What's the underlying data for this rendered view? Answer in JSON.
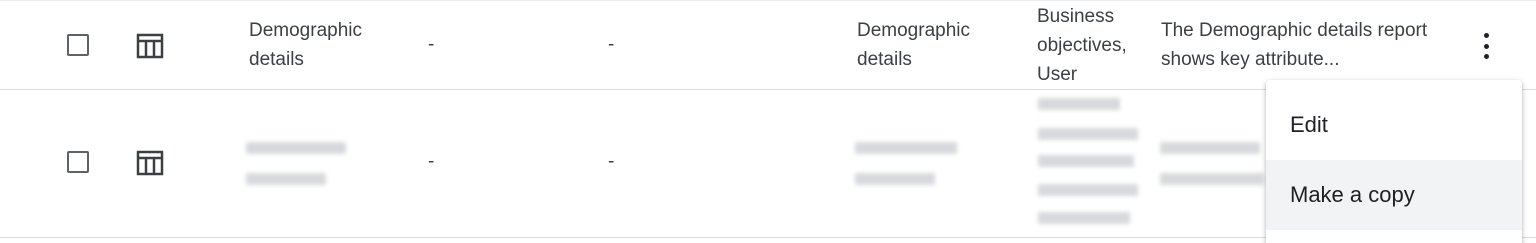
{
  "rows": [
    {
      "name": "Demographic details",
      "col2": "-",
      "col3": "-",
      "category": "Demographic details",
      "tags": "Business objectives, User",
      "description": "The Demographic details report shows key attribute..."
    },
    {
      "col2": "-",
      "col3": "-"
    }
  ],
  "icons": {
    "checkbox": "checkbox-icon",
    "report": "table-report-icon",
    "more": "more-vert-icon"
  },
  "menu": {
    "items": [
      "Edit",
      "Make a copy"
    ]
  },
  "colors": {
    "text": "#3c4043",
    "divider": "#dadce0",
    "menu_hover": "#f1f3f4"
  }
}
